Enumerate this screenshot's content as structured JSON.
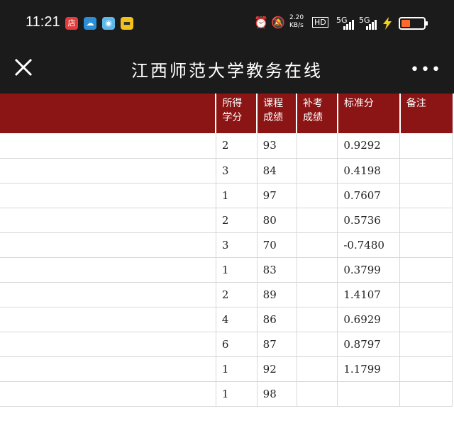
{
  "status_bar": {
    "time": "11:21",
    "app_icons": [
      "shop-icon",
      "cloud-icon",
      "camera-icon",
      "wallet-icon"
    ],
    "right_icons": [
      "alarm-icon",
      "mute-icon"
    ],
    "network_speed": "2.20 KB/s",
    "hd_label": "HD",
    "signal_1": "5G",
    "signal_2": "5G",
    "battery_color": "#ff6a2a"
  },
  "header": {
    "title": "江西师范大学教务在线",
    "more_label": "•••"
  },
  "table": {
    "header_bg": "#8b1414",
    "columns": [
      "所得学分",
      "课程成绩",
      "补考成绩",
      "标准分",
      "备注"
    ],
    "rows": [
      [
        "2",
        "93",
        "",
        "0.9292",
        ""
      ],
      [
        "3",
        "84",
        "",
        "0.4198",
        ""
      ],
      [
        "1",
        "97",
        "",
        "0.7607",
        ""
      ],
      [
        "2",
        "80",
        "",
        "0.5736",
        ""
      ],
      [
        "3",
        "70",
        "",
        "-0.7480",
        ""
      ],
      [
        "1",
        "83",
        "",
        "0.3799",
        ""
      ],
      [
        "2",
        "89",
        "",
        "1.4107",
        ""
      ],
      [
        "4",
        "86",
        "",
        "0.6929",
        ""
      ],
      [
        "6",
        "87",
        "",
        "0.8797",
        ""
      ],
      [
        "1",
        "92",
        "",
        "1.1799",
        ""
      ],
      [
        "1",
        "98",
        "",
        "",
        ""
      ]
    ]
  }
}
